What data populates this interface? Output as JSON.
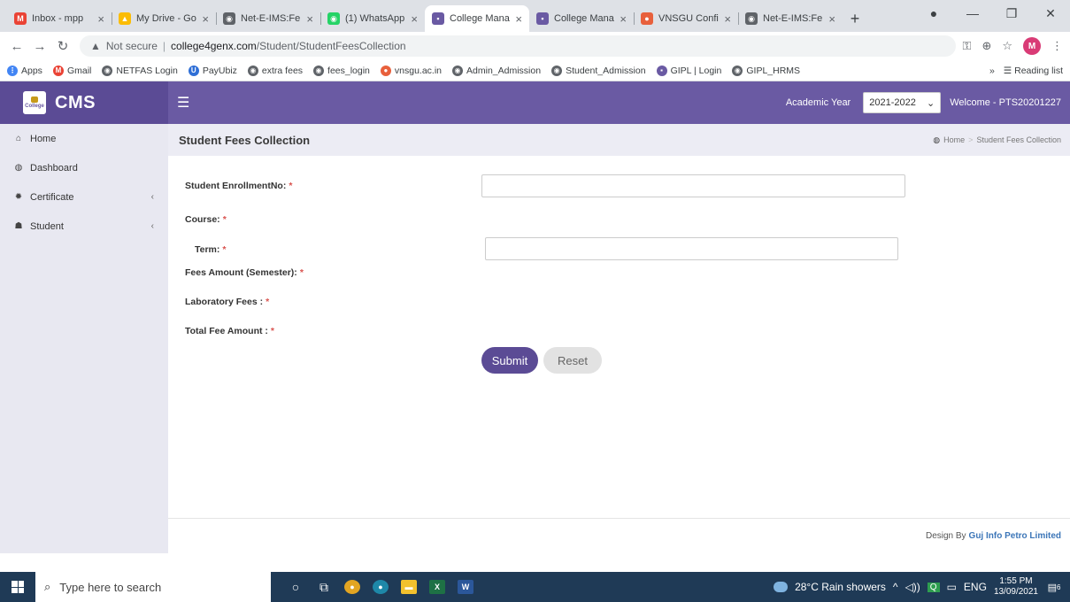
{
  "browser": {
    "tabs": [
      {
        "label": "Inbox - mpp",
        "icon_color": "#ea4335",
        "icon_glyph": "M",
        "active": false
      },
      {
        "label": "My Drive - Go",
        "icon_color": "#fbbc04",
        "icon_glyph": "▲",
        "active": false
      },
      {
        "label": "Net-E-IMS:Fe",
        "icon_color": "#5f6368",
        "icon_glyph": "◉",
        "active": false
      },
      {
        "label": "(1) WhatsApp",
        "icon_color": "#25d366",
        "icon_glyph": "◉",
        "active": false
      },
      {
        "label": "College Mana",
        "icon_color": "#6a5aa3",
        "icon_glyph": "▪",
        "active": true
      },
      {
        "label": "College Mana",
        "icon_color": "#6a5aa3",
        "icon_glyph": "▪",
        "active": false
      },
      {
        "label": "VNSGU Confi",
        "icon_color": "#e8603c",
        "icon_glyph": "●",
        "active": false
      },
      {
        "label": "Net-E-IMS:Fe",
        "icon_color": "#5f6368",
        "icon_glyph": "◉",
        "active": false
      }
    ],
    "address": {
      "security_label": "Not secure",
      "host": "college4genx.com",
      "path": "/Student/StudentFeesCollection"
    },
    "profile_initial": "M",
    "bookmarks": [
      {
        "label": "Apps",
        "icon_color": "#4285f4",
        "icon_glyph": "⋮"
      },
      {
        "label": "Gmail",
        "icon_color": "#ea4335",
        "icon_glyph": "M"
      },
      {
        "label": "NETFAS Login",
        "icon_color": "#5f6368",
        "icon_glyph": "◉"
      },
      {
        "label": "PayUbiz",
        "icon_color": "#2f6fd6",
        "icon_glyph": "U"
      },
      {
        "label": "extra fees",
        "icon_color": "#5f6368",
        "icon_glyph": "◉"
      },
      {
        "label": "fees_login",
        "icon_color": "#5f6368",
        "icon_glyph": "◉"
      },
      {
        "label": "vnsgu.ac.in",
        "icon_color": "#e8603c",
        "icon_glyph": "●"
      },
      {
        "label": "Admin_Admission",
        "icon_color": "#5f6368",
        "icon_glyph": "◉"
      },
      {
        "label": "Student_Admission",
        "icon_color": "#5f6368",
        "icon_glyph": "◉"
      },
      {
        "label": "GIPL | Login",
        "icon_color": "#6a5aa3",
        "icon_glyph": "▪"
      },
      {
        "label": "GIPL_HRMS",
        "icon_color": "#5f6368",
        "icon_glyph": "◉"
      }
    ],
    "reading_list_label": "Reading list"
  },
  "app": {
    "brand": "CMS",
    "logo_text": "College",
    "academic_year_label": "Academic Year",
    "academic_year_value": "2021-2022",
    "welcome": "Welcome - PTS20201227",
    "accent": "#6a5aa3",
    "sidebar": [
      {
        "label": "Home",
        "icon": "home-icon",
        "glyph": "⌂",
        "has_children": false
      },
      {
        "label": "Dashboard",
        "icon": "dashboard-icon",
        "glyph": "◍",
        "has_children": false
      },
      {
        "label": "Certificate",
        "icon": "certificate-icon",
        "glyph": "✹",
        "has_children": true
      },
      {
        "label": "Student",
        "icon": "student-icon",
        "glyph": "☗",
        "has_children": true
      }
    ],
    "page_title": "Student Fees Collection",
    "breadcrumb": {
      "home": "Home",
      "current": "Student Fees Collection"
    },
    "form": {
      "enrollment_label": "Student EnrollmentNo:",
      "course_label": "Course:",
      "term_label": "Term:",
      "fees_semester_label": "Fees Amount (Semester):",
      "lab_fees_label": "Laboratory Fees :",
      "total_label": "Total Fee Amount :",
      "required_mark": "*",
      "submit": "Submit",
      "reset": "Reset"
    },
    "footer": {
      "prefix": "Design By",
      "company": "Guj Info Petro Limited"
    }
  },
  "taskbar": {
    "search_placeholder": "Type here to search",
    "weather": "28°C  Rain showers",
    "language": "ENG",
    "time": "1:55 PM",
    "date": "13/09/2021",
    "notification_count": "6"
  }
}
